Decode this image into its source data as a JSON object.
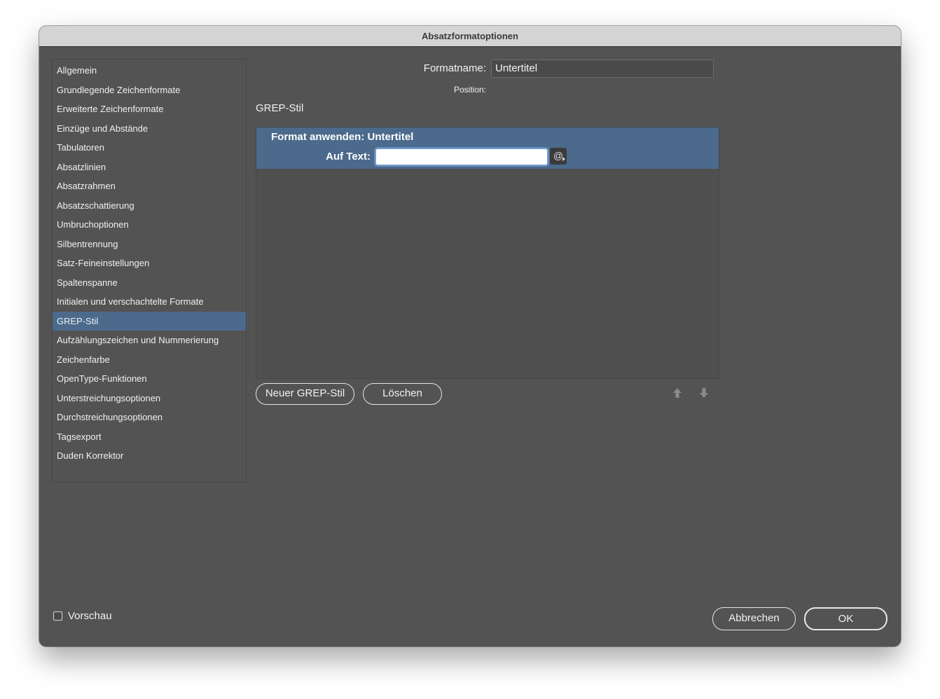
{
  "window": {
    "title": "Absatzformatoptionen"
  },
  "sidebar": {
    "items": [
      {
        "label": "Allgemein"
      },
      {
        "label": "Grundlegende Zeichenformate"
      },
      {
        "label": "Erweiterte Zeichenformate"
      },
      {
        "label": "Einzüge und Abstände"
      },
      {
        "label": "Tabulatoren"
      },
      {
        "label": "Absatzlinien"
      },
      {
        "label": "Absatzrahmen"
      },
      {
        "label": "Absatzschattierung"
      },
      {
        "label": "Umbruchoptionen"
      },
      {
        "label": "Silbentrennung"
      },
      {
        "label": "Satz-Feineinstellungen"
      },
      {
        "label": "Spaltenspanne"
      },
      {
        "label": "Initialen und verschachtelte Formate"
      },
      {
        "label": "GREP-Stil",
        "selected": true
      },
      {
        "label": "Aufzählungszeichen und Nummerierung"
      },
      {
        "label": "Zeichenfarbe"
      },
      {
        "label": "OpenType-Funktionen"
      },
      {
        "label": "Unterstreichungsoptionen"
      },
      {
        "label": "Durchstreichungsoptionen"
      },
      {
        "label": "Tagsexport"
      },
      {
        "label": "Duden Korrektor"
      }
    ]
  },
  "header": {
    "format_name_label": "Formatname:",
    "format_name_value": "Untertitel",
    "position_label": "Position:"
  },
  "grep": {
    "section_title": "GREP-Stil",
    "rule": {
      "apply_label": "Format anwenden: Untertitel",
      "to_text_label": "Auf Text:",
      "to_text_value": "",
      "special_char_glyph": "@"
    },
    "new_button": "Neuer GREP-Stil",
    "delete_button": "Löschen"
  },
  "footer": {
    "preview_label": "Vorschau",
    "preview_checked": false,
    "cancel_button": "Abbrechen",
    "ok_button": "OK"
  },
  "colors": {
    "dialog_bg": "#535353",
    "selection": "#4b6a8c",
    "titlebar": "#d4d4d4"
  }
}
